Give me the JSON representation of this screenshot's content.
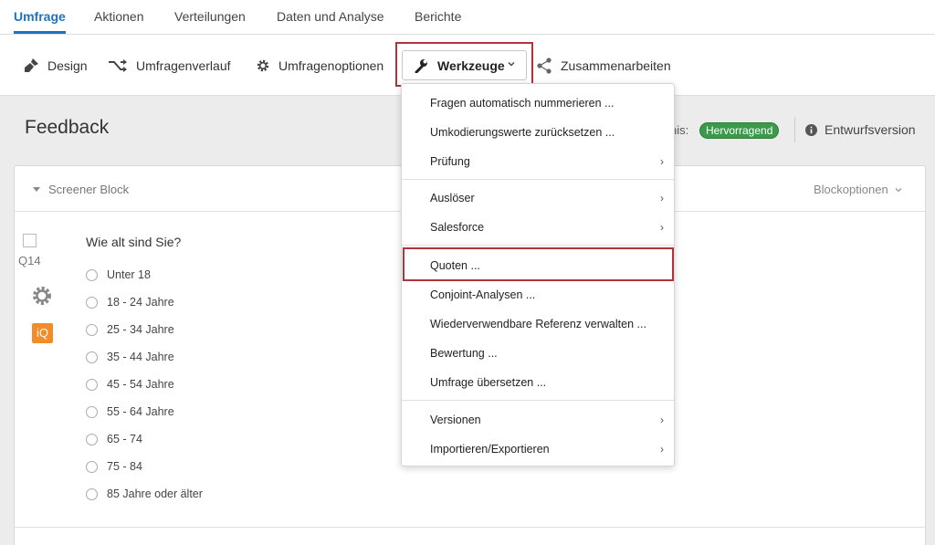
{
  "top_nav": {
    "tabs": [
      {
        "label": "Umfrage",
        "active": true
      },
      {
        "label": "Aktionen",
        "active": false
      },
      {
        "label": "Verteilungen",
        "active": false
      },
      {
        "label": "Daten und Analyse",
        "active": false
      },
      {
        "label": "Berichte",
        "active": false
      }
    ]
  },
  "toolbar": {
    "design": "Design",
    "history": "Umfragenverlauf",
    "options": "Umfragenoptionen",
    "tools": "Werkzeuge",
    "collaborate": "Zusammenarbeiten"
  },
  "header": {
    "title": "Feedback",
    "status_label": "nis:",
    "status_badge": "Hervorragend",
    "version": "Entwurfsversion"
  },
  "block": {
    "name": "Screener Block",
    "options": "Blockoptionen"
  },
  "question": {
    "number": "Q14",
    "iq_badge": "iQ",
    "text": "Wie alt sind Sie?",
    "options": [
      "Unter 18",
      "18 - 24 Jahre",
      "25 - 34 Jahre",
      "35 - 44 Jahre",
      "45 - 54 Jahre",
      "55 - 64 Jahre",
      "65 - 74",
      "75 - 84",
      "85 Jahre oder älter"
    ]
  },
  "tools_menu": {
    "items": [
      {
        "label": "Fragen automatisch nummerieren ...",
        "submenu": false
      },
      {
        "label": "Umkodierungswerte zurücksetzen ...",
        "submenu": false
      },
      {
        "label": "Prüfung",
        "submenu": true
      },
      {
        "label": "Auslöser",
        "submenu": true
      },
      {
        "label": "Salesforce",
        "submenu": true
      },
      {
        "label": "Quoten ...",
        "submenu": false
      },
      {
        "label": "Conjoint-Analysen ...",
        "submenu": false
      },
      {
        "label": "Wiederverwendbare Referenz verwalten ...",
        "submenu": false
      },
      {
        "label": "Bewertung ...",
        "submenu": false
      },
      {
        "label": "Umfrage übersetzen ...",
        "submenu": false
      },
      {
        "label": "Versionen",
        "submenu": true
      },
      {
        "label": "Importieren/Exportieren",
        "submenu": true
      }
    ],
    "arrow": "›"
  },
  "colors": {
    "accent": "#1e73be",
    "highlight": "#b0343a",
    "badge_green": "#3a9a4a",
    "iq_orange": "#f28c28"
  }
}
